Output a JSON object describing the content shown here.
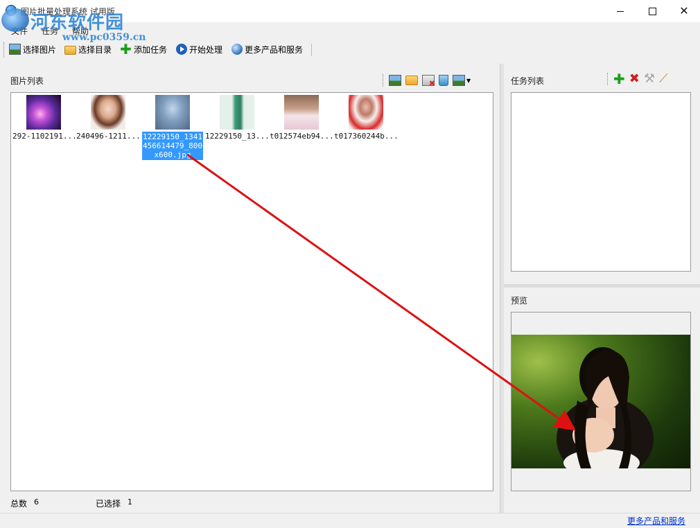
{
  "window": {
    "title": "图片批量处理系统 试用版"
  },
  "watermark": {
    "site_name": "河东软件园",
    "url": "www.pc0359.cn"
  },
  "menu": {
    "items": [
      {
        "label": "文件"
      },
      {
        "label": "任务"
      },
      {
        "label": "帮助"
      }
    ]
  },
  "toolbar": {
    "select_image": "选择图片",
    "select_folder": "选择目录",
    "add_task": "添加任务",
    "start_process": "开始处理",
    "more_products": "更多产品和服务"
  },
  "image_list": {
    "label": "图片列表",
    "items": [
      {
        "filename": "292-1102191...",
        "selected": false
      },
      {
        "filename": "240496-1211...",
        "selected": false
      },
      {
        "filename": "12229150_1341456614479_800x600.jpg",
        "selected": true
      },
      {
        "filename": "12229150_13...",
        "selected": false
      },
      {
        "filename": "t012574eb94...",
        "selected": false
      },
      {
        "filename": "t017360244b...",
        "selected": false
      }
    ]
  },
  "task_list": {
    "label": "任务列表"
  },
  "preview": {
    "label": "预览"
  },
  "status": {
    "total_label": "总数",
    "total_value": "6",
    "selected_label": "已选择",
    "selected_value": "1",
    "link": "更多产品和服务"
  },
  "colors": {
    "selection": "#3399ff",
    "annotation_arrow": "#dd1111",
    "link": "#0033cc"
  }
}
